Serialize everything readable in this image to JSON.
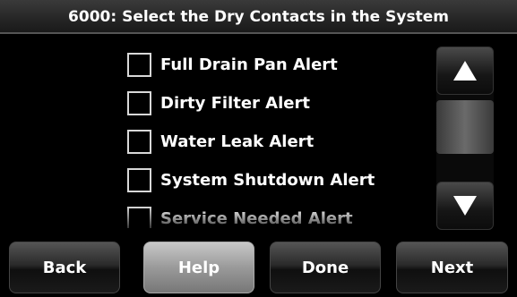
{
  "header": {
    "title": "6000: Select the Dry Contacts in the System"
  },
  "alert_list": {
    "items": [
      {
        "label": "Full Drain Pan Alert",
        "checked": false
      },
      {
        "label": "Dirty Filter Alert",
        "checked": false
      },
      {
        "label": "Water Leak Alert",
        "checked": false
      },
      {
        "label": "System Shutdown Alert",
        "checked": false
      },
      {
        "label": "Service Needed Alert",
        "checked": false
      }
    ]
  },
  "scroll": {
    "up_icon": "triangle-up",
    "down_icon": "triangle-down"
  },
  "footer": {
    "back_label": "Back",
    "help_label": "Help",
    "done_label": "Done",
    "next_label": "Next"
  },
  "colors": {
    "background": "#000000",
    "text": "#ffffff",
    "help_button": "#9a9a9a"
  }
}
